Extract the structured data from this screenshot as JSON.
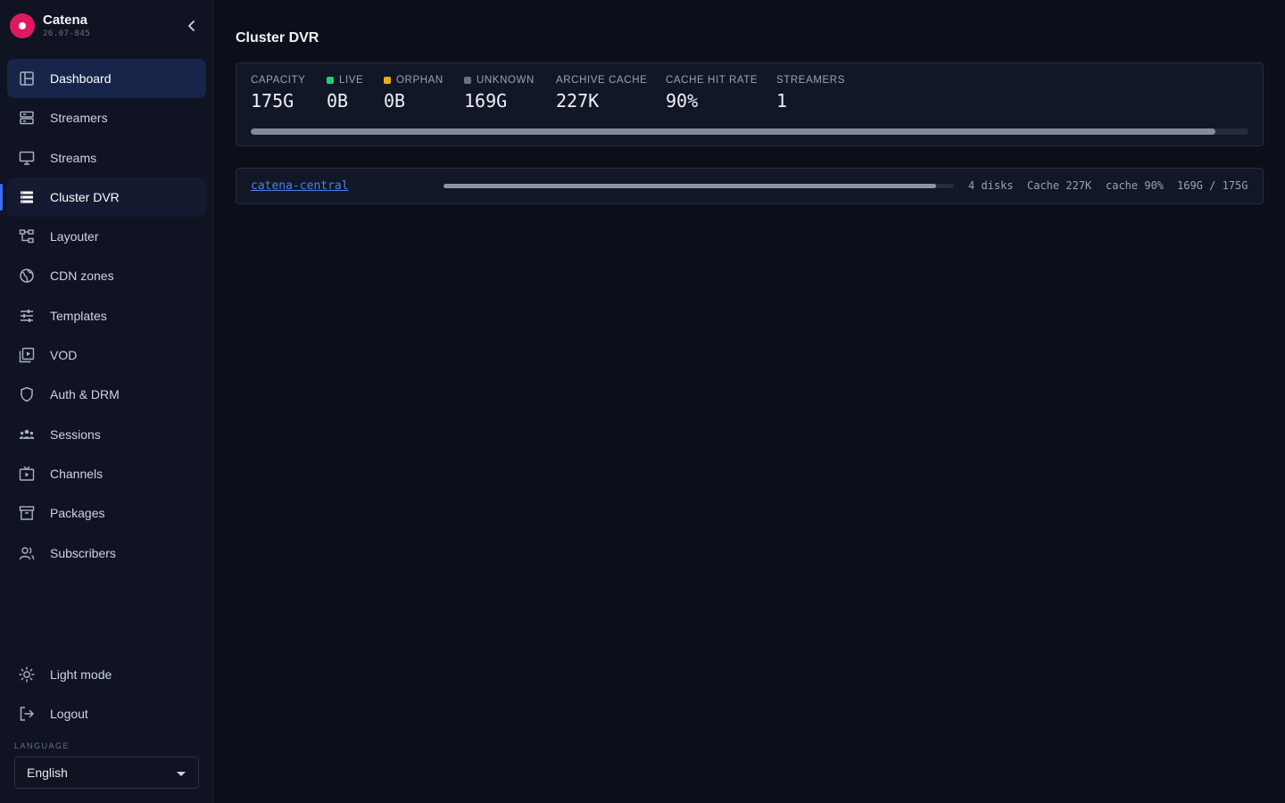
{
  "app": {
    "name": "Catena",
    "version": "26.07-845"
  },
  "sidebar": {
    "items": [
      {
        "label": "Dashboard",
        "icon": "dashboard-icon"
      },
      {
        "label": "Streamers",
        "icon": "server-icon"
      },
      {
        "label": "Streams",
        "icon": "monitor-icon"
      },
      {
        "label": "Cluster DVR",
        "icon": "storage-list-icon"
      },
      {
        "label": "Layouter",
        "icon": "layout-tree-icon"
      },
      {
        "label": "CDN zones",
        "icon": "globe-icon"
      },
      {
        "label": "Templates",
        "icon": "sliders-icon"
      },
      {
        "label": "VOD",
        "icon": "video-library-icon"
      },
      {
        "label": "Auth & DRM",
        "icon": "shield-icon"
      },
      {
        "label": "Sessions",
        "icon": "users-group-icon"
      },
      {
        "label": "Channels",
        "icon": "tv-icon"
      },
      {
        "label": "Packages",
        "icon": "archive-box-icon"
      },
      {
        "label": "Subscribers",
        "icon": "users-icon"
      }
    ],
    "active_item": "Cluster DVR",
    "light_mode_label": "Light mode",
    "logout_label": "Logout",
    "language_label": "LANGUAGE",
    "language_value": "English"
  },
  "page": {
    "title": "Cluster DVR"
  },
  "summary": {
    "stats": [
      {
        "label": "CAPACITY",
        "value": "175G"
      },
      {
        "label": "LIVE",
        "value": "0B",
        "dot_color": "#1fcf7c"
      },
      {
        "label": "ORPHAN",
        "value": "0B",
        "dot_color": "#f0a823"
      },
      {
        "label": "UNKNOWN",
        "value": "169G",
        "dot_color": "#6b7181"
      },
      {
        "label": "ARCHIVE CACHE",
        "value": "227K"
      },
      {
        "label": "CACHE HIT RATE",
        "value": "90%"
      },
      {
        "label": "STREAMERS",
        "value": "1"
      }
    ],
    "usage_fraction": 0.967
  },
  "nodes": [
    {
      "name": "catena-central",
      "usage_fraction": 0.965,
      "disks": "4 disks",
      "cache": "Cache 227K",
      "cache_rate": "cache 90%",
      "usage": "169G / 175G"
    }
  ],
  "colors": {
    "accent": "#3b6cf6",
    "brand": "#e0185f",
    "link": "#4f7ef0",
    "live": "#1fcf7c",
    "orphan": "#f0a823",
    "unknown": "#6b7181"
  }
}
